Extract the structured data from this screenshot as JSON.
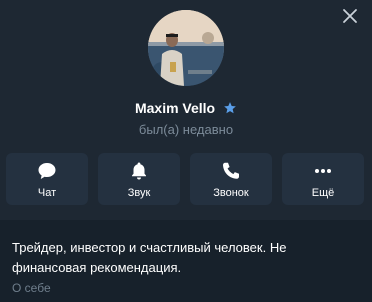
{
  "profile": {
    "name": "Maxim Vello",
    "status": "был(а) недавно",
    "badge_icon": "premium-star-icon"
  },
  "actions": [
    {
      "label": "Чат",
      "icon": "chat-bubble-icon"
    },
    {
      "label": "Звук",
      "icon": "bell-icon"
    },
    {
      "label": "Звонок",
      "icon": "phone-icon"
    },
    {
      "label": "Ещё",
      "icon": "more-dots-icon"
    }
  ],
  "about": {
    "bio": "Трейдер, инвестор и счастливый человек. Не финансовая рекомендация.",
    "label": "О себе"
  },
  "colors": {
    "background": "#17212b",
    "header": "#1e2833",
    "button": "#243140",
    "accent_star": "#5a9ee8",
    "muted_text": "#7c8b99"
  }
}
